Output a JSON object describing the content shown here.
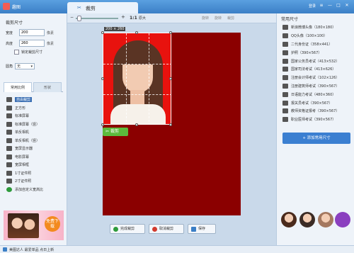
{
  "titlebar": {
    "app_name": "趣图",
    "tab_label": "裁剪",
    "login": "登录",
    "controls": [
      "≡",
      "—",
      "□",
      "✕"
    ]
  },
  "left": {
    "title": "裁剪尺寸",
    "width_label": "宽度",
    "width_value": "200",
    "width_unit": "像素",
    "height_label": "高度",
    "height_value": "260",
    "height_unit": "像素",
    "lock_label": "锁定裁剪尺寸",
    "rounded_label": "圆角",
    "rounded_value": "无",
    "tabs": [
      "常用比例",
      "形状"
    ],
    "ratios": [
      "自由裁剪",
      "正方形",
      "标准屏幕",
      "标准屏幕（竖）",
      "单反相机",
      "单反相机（竖）",
      "宽屏显示器",
      "电影屏幕",
      "宽屏相框",
      "1寸证件照",
      "2寸证件照",
      "添加自定义宽高比"
    ],
    "ad_badge": "免费下载"
  },
  "toolbar": {
    "zoom_out": "−",
    "zoom_in": "+",
    "ratio": "1:1",
    "original": "原大",
    "tools": [
      "旋转",
      "旋转",
      "裁剪"
    ]
  },
  "canvas": {
    "dimension_tag": "200 × 260",
    "crop_button": "裁剪"
  },
  "bottom": {
    "done": "完成裁剪",
    "cancel": "取消裁剪",
    "save": "保存"
  },
  "right": {
    "title": "常用尺寸",
    "sizes": [
      "新浪微博头像（180×180）",
      "QQ头像（100×100）",
      "二代身份证（358×441）",
      "护照（390×567）",
      "国家公务员考试（413×532）",
      "国家司法考试（413×626）",
      "注册会计师考试（102×126）",
      "注册建筑师考试（390×567）",
      "日语能力考试（480×360）",
      "报关员考试（390×567）",
      "教师资格证报考（390×567）",
      "职业医师考试（390×567）"
    ],
    "add_button": "+ 添加常用尺寸"
  },
  "status": {
    "text": "美图达人 最爱单品 点日上新"
  },
  "colors": {
    "accent": "#3b7fc6",
    "canvas_bg": "#8b0000",
    "photo_bg": "#e8120e",
    "crop_green": "#5cba3c"
  }
}
